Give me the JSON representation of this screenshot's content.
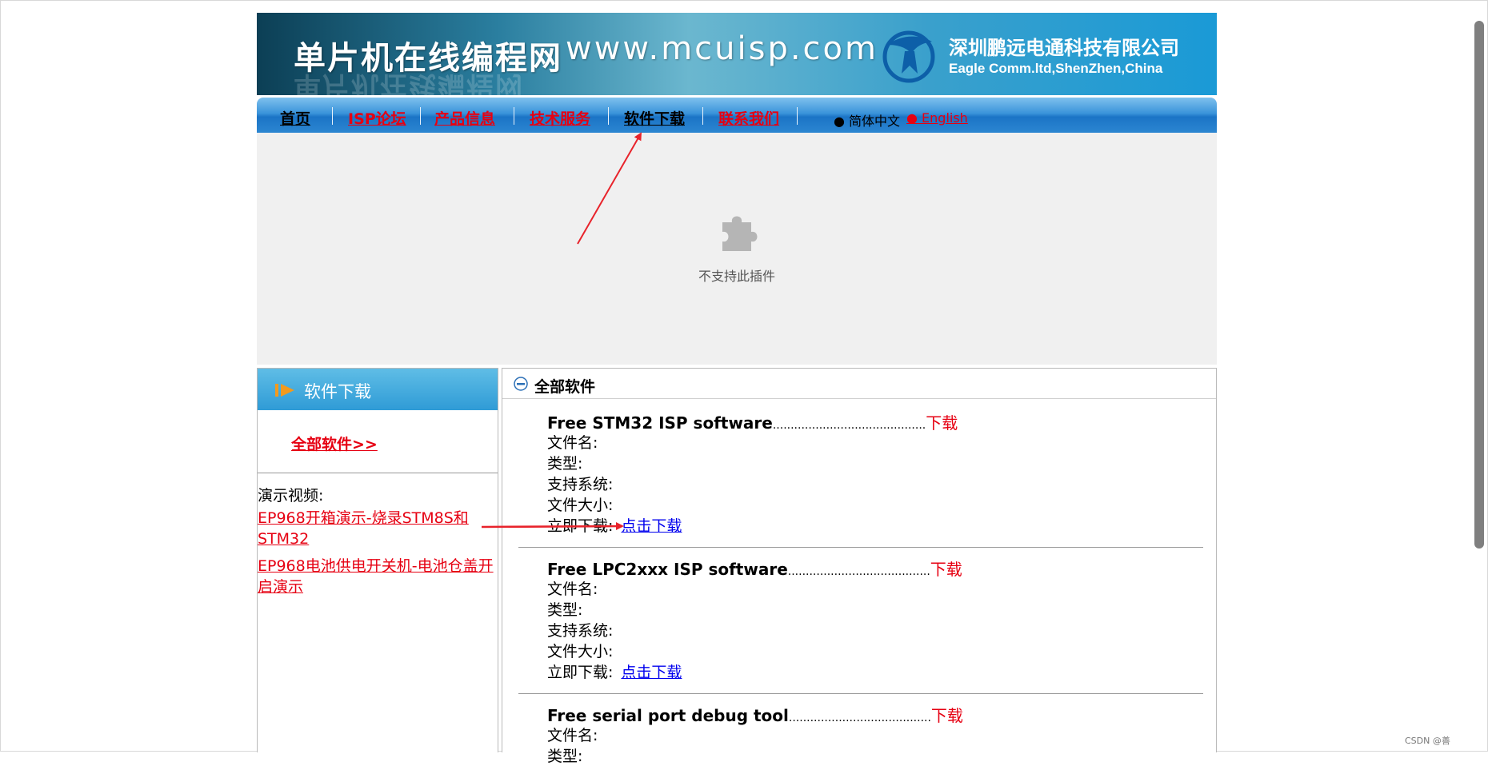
{
  "banner": {
    "title": "单片机在线编程网",
    "url": "www.mcuisp.com",
    "company_name": "深圳鹏远电通科技有限公司",
    "company_en": "Eagle Comm.ltd,ShenZhen,China"
  },
  "nav": {
    "items": [
      {
        "label": "首页",
        "color": "#000000"
      },
      {
        "label": "ISP论坛",
        "color": "#e60012"
      },
      {
        "label": "产品信息",
        "color": "#e60012"
      },
      {
        "label": "技术服务",
        "color": "#e60012"
      },
      {
        "label": "软件下载",
        "color": "#000000"
      },
      {
        "label": "联系我们",
        "color": "#e60012"
      }
    ],
    "lang_cn": "● 简体中文",
    "lang_en": "● English"
  },
  "plugin": {
    "icon": "puzzle-piece-icon",
    "message": "不支持此插件"
  },
  "sidebar": {
    "title": "软件下载",
    "all_software": "全部软件>>",
    "video_label": "演示视频:",
    "videos": [
      "EP968开箱演示-烧录STM8S和STM32",
      "EP968电池供电开关机-电池仓盖开启演示"
    ]
  },
  "main": {
    "title": "全部软件",
    "entries": [
      {
        "name": "Free STM32 ISP software",
        "dots": "...........................................",
        "download": "下载",
        "file_name": "文件名:",
        "type": "类型:",
        "os": "支持系统:",
        "size": "文件大小:",
        "now": "立即下载:",
        "link": "点击下载"
      },
      {
        "name": "Free LPC2xxx ISP software",
        "dots": "........................................",
        "download": "下载",
        "file_name": "文件名:",
        "type": "类型:",
        "os": "支持系统:",
        "size": "文件大小:",
        "now": "立即下载:",
        "link": "点击下载"
      },
      {
        "name": "Free serial port debug tool",
        "dots": "........................................",
        "download": "下载",
        "file_name": "文件名:",
        "type": "类型:"
      }
    ]
  },
  "watermark": "CSDN @善",
  "colors": {
    "accent_red": "#e60012",
    "link_blue": "#0000ee",
    "nav_blue": "#1b74c6"
  }
}
